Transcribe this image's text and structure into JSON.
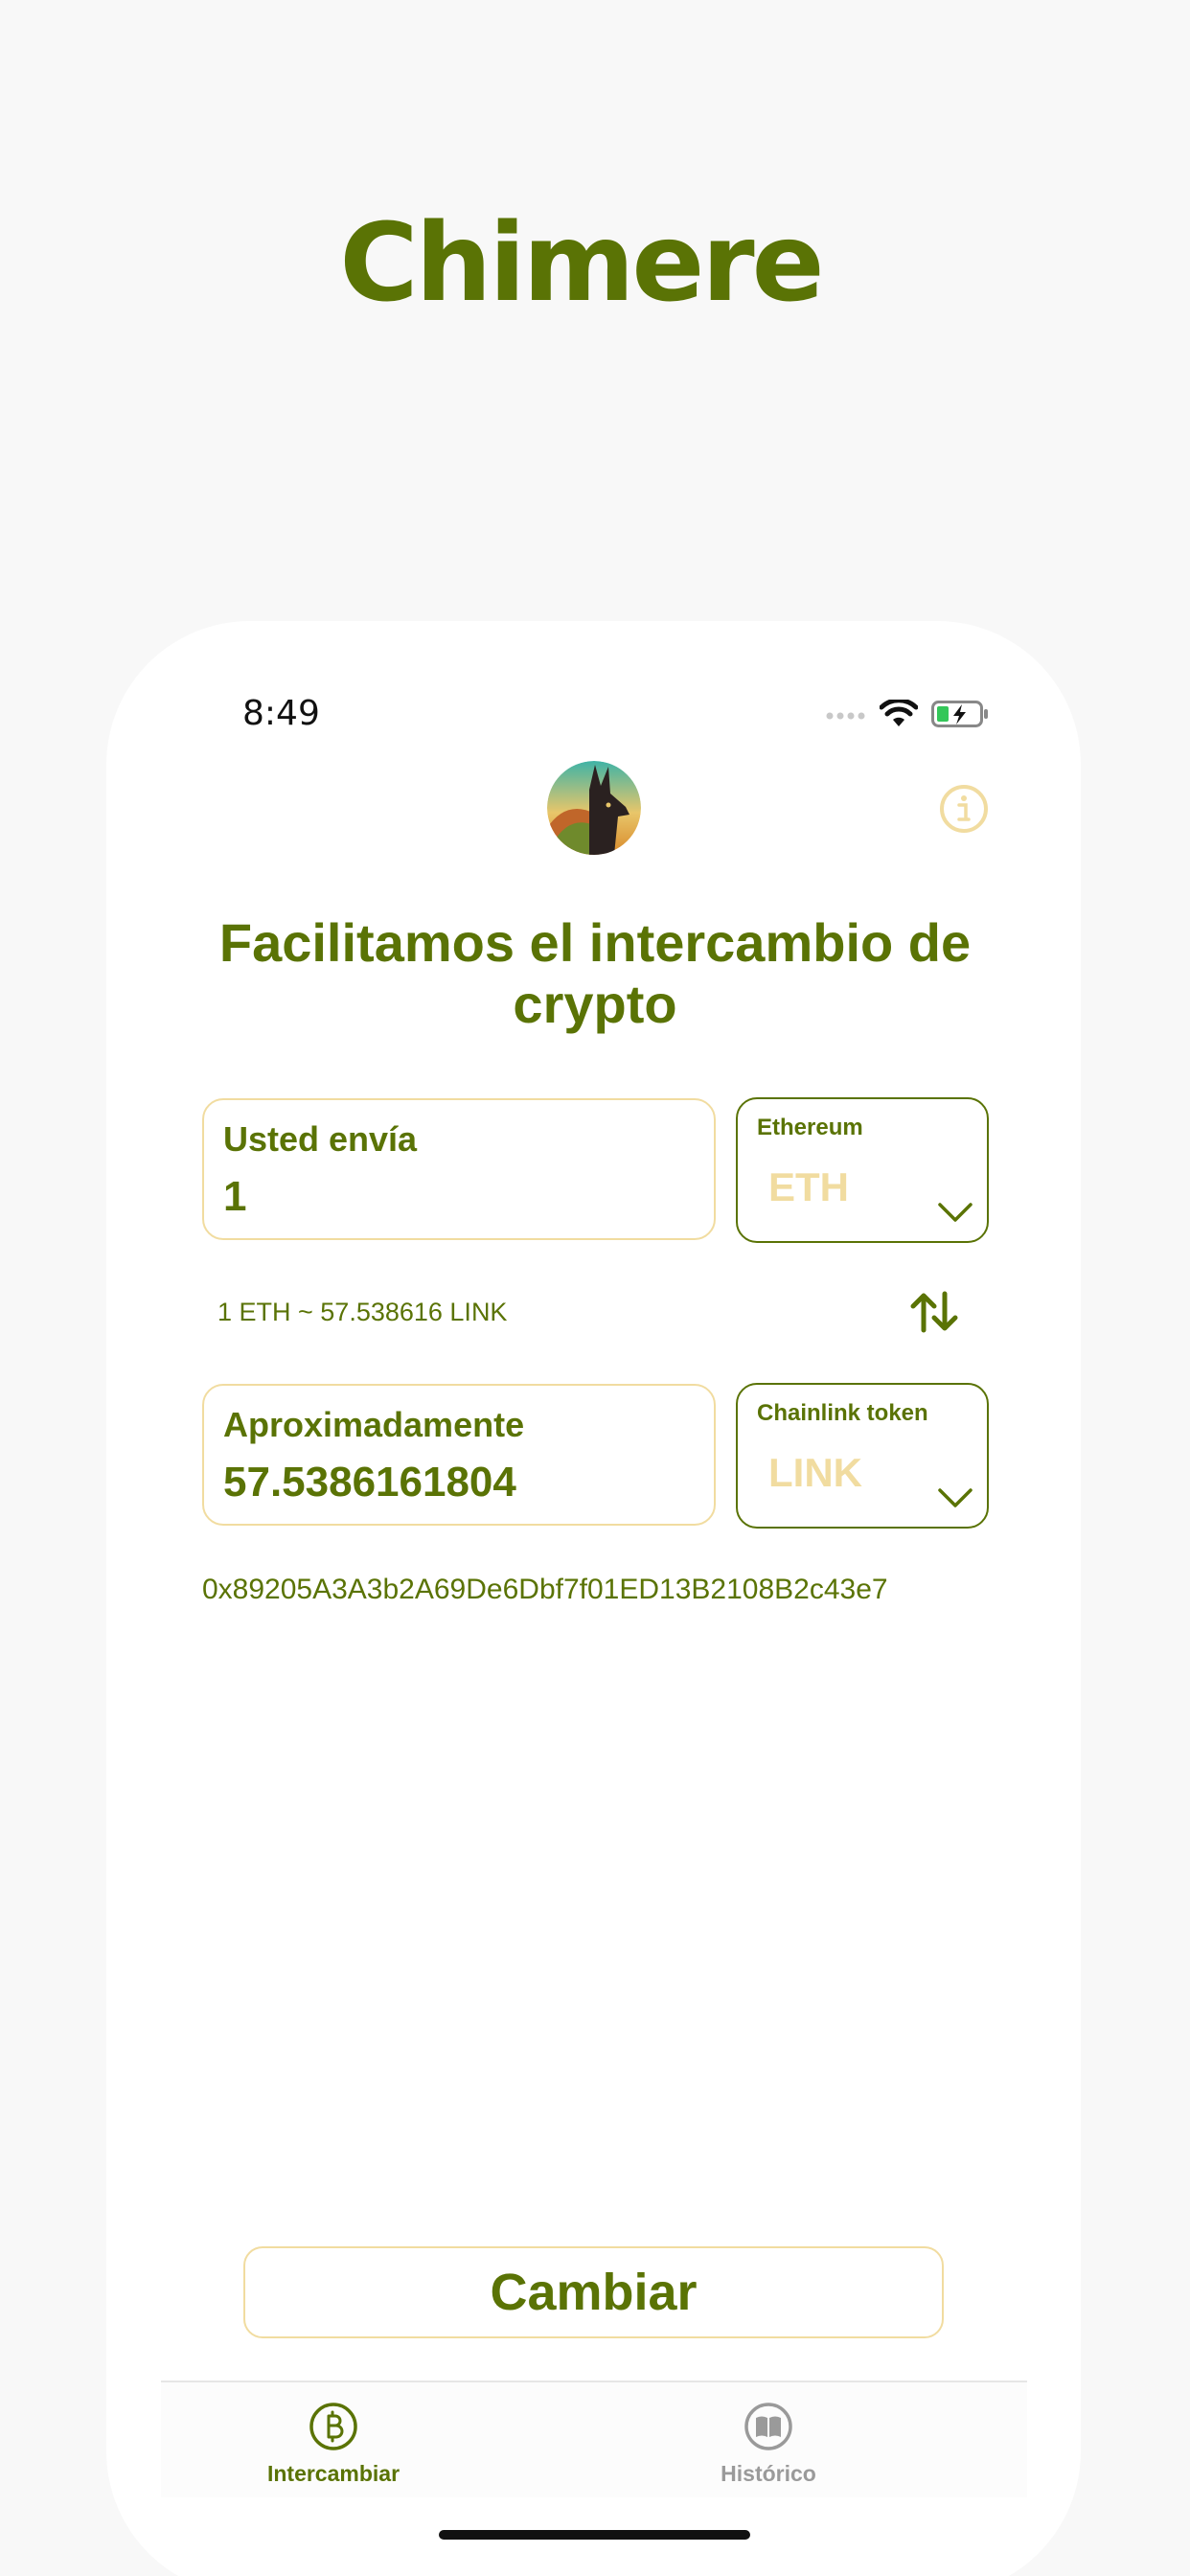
{
  "brand": {
    "title": "Chimere"
  },
  "status_bar": {
    "time": "8:49"
  },
  "headline": "Facilitamos el intercambio de crypto",
  "send": {
    "label": "Usted envía",
    "value": "1",
    "token_name": "Ethereum",
    "token_symbol": "ETH"
  },
  "rate": "1 ETH ~ 57.538616 LINK",
  "receive": {
    "label": "Aproximadamente",
    "value": "57.5386161804",
    "token_name": "Chainlink token",
    "token_symbol": "LINK"
  },
  "address": "0x89205A3A3b2A69De6Dbf7f01ED13B2108B2c43e7",
  "action_button": "Cambiar",
  "tabs": [
    {
      "label": "Intercambiar",
      "icon": "bitcoin-icon",
      "active": true
    },
    {
      "label": "Histórico",
      "icon": "book-icon",
      "active": false
    }
  ],
  "colors": {
    "primary": "#5a7305",
    "accent_light": "#f1dca0",
    "inactive": "#9a9a9a",
    "background": "#f8f8f8"
  }
}
